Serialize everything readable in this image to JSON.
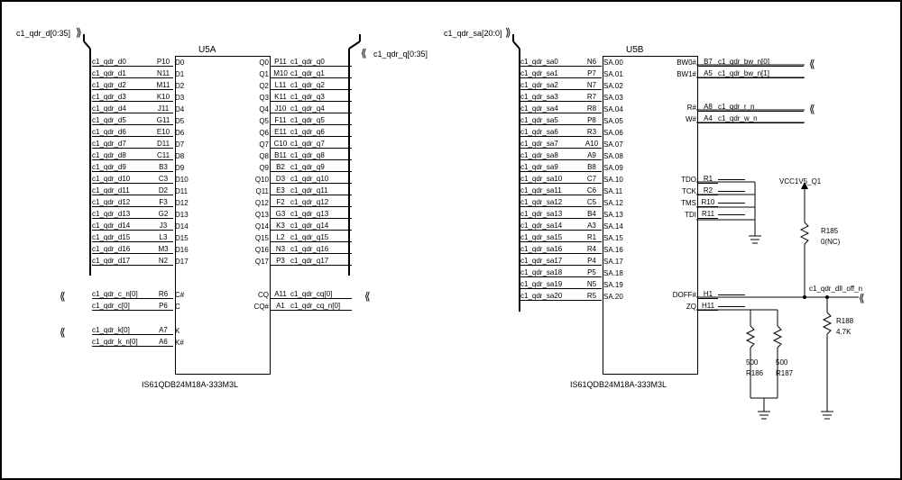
{
  "title_u5a": "U5A",
  "title_u5b": "U5B",
  "part_name": "IS61QDB24M18A-333M3L",
  "bus_d": "c1_qdr_d[0:35]",
  "bus_q": "c1_qdr_q[0:35]",
  "bus_sa": "c1_qdr_sa[20:0]",
  "c_n": "c1_qdr_c_n[0]",
  "c": "c1_qdr_c[0]",
  "k": "c1_qdr_k[0]",
  "k_n": "c1_qdr_k_n[0]",
  "cq": "c1_qdr_cq[0]",
  "cq_n": "c1_qdr_cq_n[0]",
  "bw0": "c1_qdr_bw_n[0]",
  "bw1": "c1_qdr_bw_n[1]",
  "r_n": "c1_qdr_r_n",
  "w_n": "c1_qdr_w_n",
  "dll_off": "c1_qdr_dll_off_n",
  "vcc": "VCC1V5_Q1",
  "r185": "R185",
  "r185v": "0(NC)",
  "r188": "R188",
  "r188v": "4.7K",
  "r186": "R186",
  "r187": "R187",
  "r500": "500",
  "u5a_d": [
    {
      "net": "c1_qdr_d0",
      "num": "P10",
      "name": "D0"
    },
    {
      "net": "c1_qdr_d1",
      "num": "N11",
      "name": "D1"
    },
    {
      "net": "c1_qdr_d2",
      "num": "M11",
      "name": "D2"
    },
    {
      "net": "c1_qdr_d3",
      "num": "K10",
      "name": "D3"
    },
    {
      "net": "c1_qdr_d4",
      "num": "J11",
      "name": "D4"
    },
    {
      "net": "c1_qdr_d5",
      "num": "G11",
      "name": "D5"
    },
    {
      "net": "c1_qdr_d6",
      "num": "E10",
      "name": "D6"
    },
    {
      "net": "c1_qdr_d7",
      "num": "D11",
      "name": "D7"
    },
    {
      "net": "c1_qdr_d8",
      "num": "C11",
      "name": "D8"
    },
    {
      "net": "c1_qdr_d9",
      "num": "B3",
      "name": "D9"
    },
    {
      "net": "c1_qdr_d10",
      "num": "C3",
      "name": "D10"
    },
    {
      "net": "c1_qdr_d11",
      "num": "D2",
      "name": "D11"
    },
    {
      "net": "c1_qdr_d12",
      "num": "F3",
      "name": "D12"
    },
    {
      "net": "c1_qdr_d13",
      "num": "G2",
      "name": "D13"
    },
    {
      "net": "c1_qdr_d14",
      "num": "J3",
      "name": "D14"
    },
    {
      "net": "c1_qdr_d15",
      "num": "L3",
      "name": "D15"
    },
    {
      "net": "c1_qdr_d16",
      "num": "M3",
      "name": "D16"
    },
    {
      "net": "c1_qdr_d17",
      "num": "N2",
      "name": "D17"
    }
  ],
  "u5a_q": [
    {
      "net": "c1_qdr_q0",
      "num": "P11",
      "name": "Q0"
    },
    {
      "net": "c1_qdr_q1",
      "num": "M10",
      "name": "Q1"
    },
    {
      "net": "c1_qdr_q2",
      "num": "L11",
      "name": "Q2"
    },
    {
      "net": "c1_qdr_q3",
      "num": "K11",
      "name": "Q3"
    },
    {
      "net": "c1_qdr_q4",
      "num": "J10",
      "name": "Q4"
    },
    {
      "net": "c1_qdr_q5",
      "num": "F11",
      "name": "Q5"
    },
    {
      "net": "c1_qdr_q6",
      "num": "E11",
      "name": "Q6"
    },
    {
      "net": "c1_qdr_q7",
      "num": "C10",
      "name": "Q7"
    },
    {
      "net": "c1_qdr_q8",
      "num": "B11",
      "name": "Q8"
    },
    {
      "net": "c1_qdr_q9",
      "num": "B2",
      "name": "Q9"
    },
    {
      "net": "c1_qdr_q10",
      "num": "D3",
      "name": "Q10"
    },
    {
      "net": "c1_qdr_q11",
      "num": "E3",
      "name": "Q11"
    },
    {
      "net": "c1_qdr_q12",
      "num": "F2",
      "name": "Q12"
    },
    {
      "net": "c1_qdr_q13",
      "num": "G3",
      "name": "Q13"
    },
    {
      "net": "c1_qdr_q14",
      "num": "K3",
      "name": "Q14"
    },
    {
      "net": "c1_qdr_q15",
      "num": "L2",
      "name": "Q15"
    },
    {
      "net": "c1_qdr_q16",
      "num": "N3",
      "name": "Q16"
    },
    {
      "net": "c1_qdr_q17",
      "num": "P3",
      "name": "Q17"
    }
  ],
  "u5a_cl": [
    {
      "net": "c1_qdr_c_n[0]",
      "num": "R6",
      "name": "C#"
    },
    {
      "net": "c1_qdr_c[0]",
      "num": "P6",
      "name": "C"
    }
  ],
  "u5a_kl": [
    {
      "net": "c1_qdr_k[0]",
      "num": "A7",
      "name": "K"
    },
    {
      "net": "c1_qdr_k_n[0]",
      "num": "A6",
      "name": "K#"
    }
  ],
  "u5a_cq": [
    {
      "net": "c1_qdr_cq[0]",
      "num": "A11",
      "name": "CQ"
    },
    {
      "net": "c1_qdr_cq_n[0]",
      "num": "A1",
      "name": "CQ#"
    }
  ],
  "u5b_sa": [
    {
      "net": "c1_qdr_sa0",
      "num": "N6",
      "name": "SA.00"
    },
    {
      "net": "c1_qdr_sa1",
      "num": "P7",
      "name": "SA.01"
    },
    {
      "net": "c1_qdr_sa2",
      "num": "N7",
      "name": "SA.02"
    },
    {
      "net": "c1_qdr_sa3",
      "num": "R7",
      "name": "SA.03"
    },
    {
      "net": "c1_qdr_sa4",
      "num": "R8",
      "name": "SA.04"
    },
    {
      "net": "c1_qdr_sa5",
      "num": "P8",
      "name": "SA.05"
    },
    {
      "net": "c1_qdr_sa6",
      "num": "R3",
      "name": "SA.06"
    },
    {
      "net": "c1_qdr_sa7",
      "num": "A10",
      "name": "SA.07"
    },
    {
      "net": "c1_qdr_sa8",
      "num": "A9",
      "name": "SA.08"
    },
    {
      "net": "c1_qdr_sa9",
      "num": "B8",
      "name": "SA.09"
    },
    {
      "net": "c1_qdr_sa10",
      "num": "C7",
      "name": "SA.10"
    },
    {
      "net": "c1_qdr_sa11",
      "num": "C6",
      "name": "SA.11"
    },
    {
      "net": "c1_qdr_sa12",
      "num": "C5",
      "name": "SA.12"
    },
    {
      "net": "c1_qdr_sa13",
      "num": "B4",
      "name": "SA.13"
    },
    {
      "net": "c1_qdr_sa14",
      "num": "A3",
      "name": "SA.14"
    },
    {
      "net": "c1_qdr_sa15",
      "num": "R1",
      "name": "SA.15"
    },
    {
      "net": "c1_qdr_sa16",
      "num": "R4",
      "name": "SA.16"
    },
    {
      "net": "c1_qdr_sa17",
      "num": "P4",
      "name": "SA.17"
    },
    {
      "net": "c1_qdr_sa18",
      "num": "P5",
      "name": "SA.18"
    },
    {
      "net": "c1_qdr_sa19",
      "num": "N5",
      "name": "SA.19"
    },
    {
      "net": "c1_qdr_sa20",
      "num": "R5",
      "name": "SA.20"
    }
  ],
  "u5b_bw": [
    {
      "net": "c1_qdr_bw_n[0]",
      "num": "B7",
      "name": "BW0#"
    },
    {
      "net": "c1_qdr_bw_n[1]",
      "num": "A5",
      "name": "BW1#"
    }
  ],
  "u5b_rw": [
    {
      "net": "c1_qdr_r_n",
      "num": "A8",
      "name": "R#"
    },
    {
      "net": "c1_qdr_w_n",
      "num": "A4",
      "name": "W#"
    }
  ],
  "u5b_jtag": [
    {
      "net": "",
      "num": "R1",
      "name": "TDO"
    },
    {
      "net": "",
      "num": "R2",
      "name": "TCK"
    },
    {
      "net": "",
      "num": "R10",
      "name": "TMS"
    },
    {
      "net": "",
      "num": "R11",
      "name": "TDI"
    }
  ],
  "u5b_dz": [
    {
      "net": "",
      "num": "H1",
      "name": "DOFF#"
    },
    {
      "net": "",
      "num": "H11",
      "name": "ZQ"
    }
  ]
}
